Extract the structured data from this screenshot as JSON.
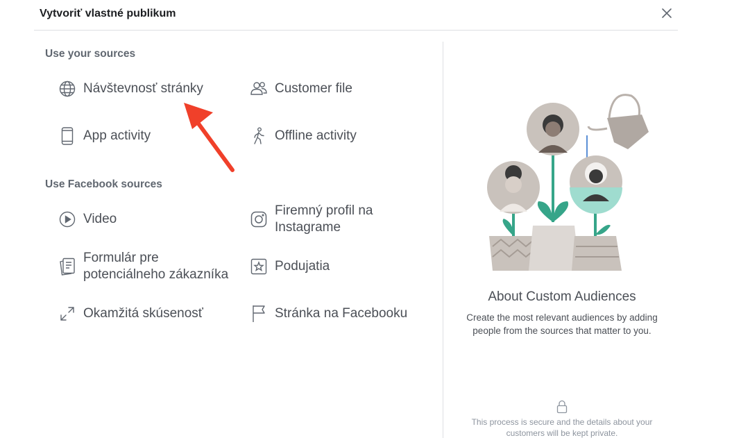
{
  "dialog": {
    "title": "Vytvoriť vlastné publikum",
    "close_icon": "close-icon"
  },
  "sections": {
    "your_sources_label": "Use your sources",
    "facebook_sources_label": "Use Facebook sources"
  },
  "options": {
    "website": {
      "label": "Návštevnosť stránky",
      "icon": "globe-icon"
    },
    "customer_file": {
      "label": "Customer file",
      "icon": "people-icon"
    },
    "app_activity": {
      "label": "App activity",
      "icon": "phone-icon"
    },
    "offline_activity": {
      "label": "Offline activity",
      "icon": "walking-person-icon"
    },
    "video": {
      "label": "Video",
      "icon": "play-icon"
    },
    "instagram": {
      "label": "Firemný profil na Instagrame",
      "icon": "instagram-icon"
    },
    "lead_form": {
      "label": "Formulár pre potenciálneho zákazníka",
      "icon": "form-icon"
    },
    "events": {
      "label": "Podujatia",
      "icon": "star-calendar-icon"
    },
    "instant_experience": {
      "label": "Okamžitá skúsenosť",
      "icon": "expand-icon"
    },
    "facebook_page": {
      "label": "Stránka na Facebooku",
      "icon": "flag-icon"
    }
  },
  "about": {
    "title": "About Custom Audiences",
    "description": "Create the most relevant audiences by adding people from the sources that matter to you.",
    "secure_note": "This process is secure and the details about your customers will be kept private."
  },
  "colors": {
    "annotation_arrow": "#f0402a",
    "plant_green": "#36a589",
    "pot_gray": "#c9c2bc"
  }
}
